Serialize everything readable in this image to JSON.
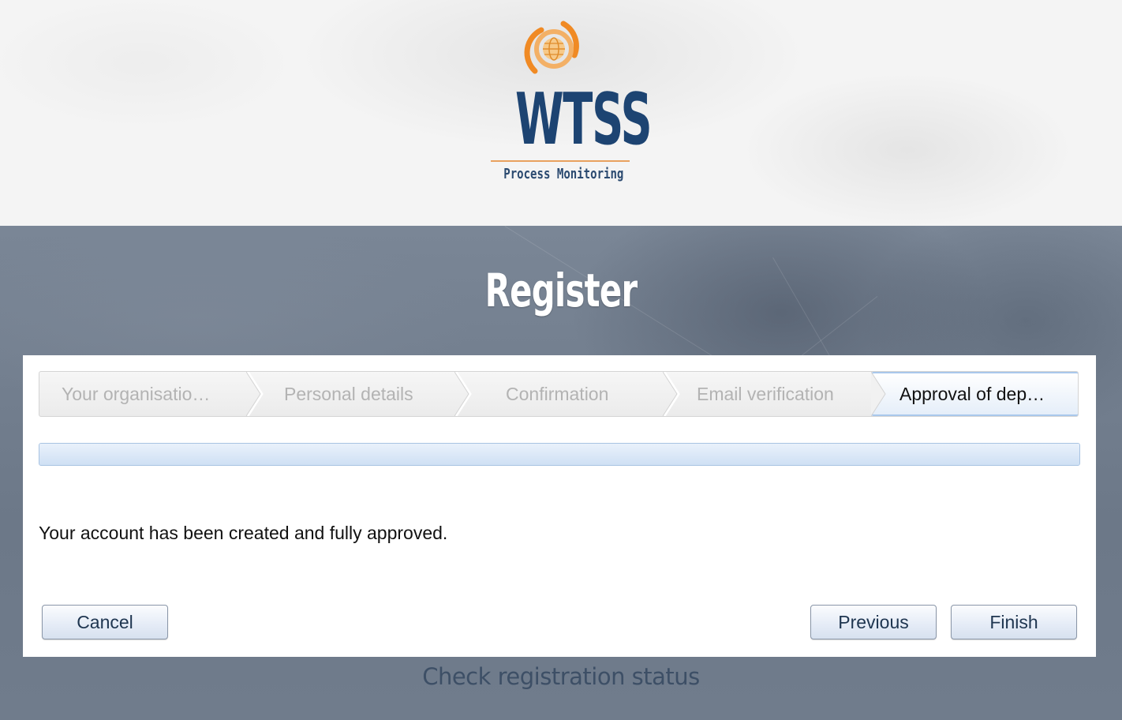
{
  "brand": {
    "name": "WTSS",
    "tagline": "Process Monitoring",
    "primary_color": "#1d4472",
    "accent_color": "#e9a15e",
    "mark_icon": "orbit-globe-icon"
  },
  "page": {
    "title": "Register"
  },
  "wizard": {
    "steps": [
      {
        "label": "Your organisatio…",
        "state": "complete"
      },
      {
        "label": "Personal details",
        "state": "complete"
      },
      {
        "label": "Confirmation",
        "state": "complete"
      },
      {
        "label": "Email verification",
        "state": "complete"
      },
      {
        "label": "Approval of dep…",
        "state": "current"
      }
    ],
    "progress_percent": 100,
    "message": "Your account has been created and fully approved.",
    "buttons": {
      "cancel": "Cancel",
      "previous": "Previous",
      "finish": "Finish"
    }
  },
  "footer": {
    "status_link": "Check registration status"
  }
}
